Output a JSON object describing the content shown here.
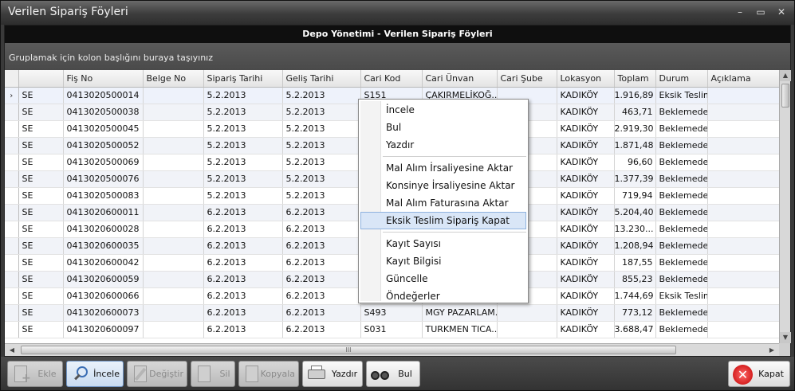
{
  "window": {
    "title": "Verilen Sipariş Föyleri",
    "controls": [
      "–",
      "▭",
      "✕"
    ]
  },
  "panel": {
    "header": "Depo Yönetimi - Verilen Sipariş Föyleri",
    "group_hint": "Gruplamak için kolon başlığını buraya taşıyınız"
  },
  "grid": {
    "columns": [
      "",
      "Fiş No",
      "Belge No",
      "Sipariş Tarihi",
      "Geliş Tarihi",
      "Cari Kod",
      "Cari Ünvan",
      "Cari Şube",
      "Lokasyon",
      "Toplam",
      "Durum",
      "Açıklama"
    ],
    "rows": [
      [
        "SE",
        "0413020500014",
        "",
        "5.2.2013",
        "5.2.2013",
        "S151",
        "ÇAKIRMELİKOĞ...",
        "",
        "KADIKÖY",
        "1.916,89",
        "Eksik Teslim",
        ""
      ],
      [
        "SE",
        "0413020500038",
        "",
        "5.2.2013",
        "5.2.2013",
        "",
        "",
        "",
        "KADIKÖY",
        "463,71",
        "Beklemede",
        ""
      ],
      [
        "SE",
        "0413020500045",
        "",
        "5.2.2013",
        "5.2.2013",
        "",
        "",
        "",
        "KADIKÖY",
        "2.919,30",
        "Beklemede",
        ""
      ],
      [
        "SE",
        "0413020500052",
        "",
        "5.2.2013",
        "5.2.2013",
        "",
        "",
        "",
        "KADIKÖY",
        "1.871,48",
        "Beklemede",
        ""
      ],
      [
        "SE",
        "0413020500069",
        "",
        "5.2.2013",
        "5.2.2013",
        "",
        "",
        "",
        "KADIKÖY",
        "96,60",
        "Beklemede",
        ""
      ],
      [
        "SE",
        "0413020500076",
        "",
        "5.2.2013",
        "5.2.2013",
        "",
        "",
        "",
        "KADIKÖY",
        "1.377,39",
        "Beklemede",
        ""
      ],
      [
        "SE",
        "0413020500083",
        "",
        "5.2.2013",
        "5.2.2013",
        "",
        "",
        "",
        "KADIKÖY",
        "719,94",
        "Beklemede",
        ""
      ],
      [
        "SE",
        "0413020600011",
        "",
        "6.2.2013",
        "6.2.2013",
        "",
        "",
        "",
        "KADIKÖY",
        "5.204,40",
        "Beklemede",
        ""
      ],
      [
        "SE",
        "0413020600028",
        "",
        "6.2.2013",
        "6.2.2013",
        "",
        "",
        "",
        "KADIKÖY",
        "13.230...",
        "Beklemede",
        ""
      ],
      [
        "SE",
        "0413020600035",
        "",
        "6.2.2013",
        "6.2.2013",
        "",
        "",
        "",
        "KADIKÖY",
        "1.208,94",
        "Beklemede",
        ""
      ],
      [
        "SE",
        "0413020600042",
        "",
        "6.2.2013",
        "6.2.2013",
        "",
        "",
        "",
        "KADIKÖY",
        "187,55",
        "Beklemede",
        ""
      ],
      [
        "SE",
        "0413020600059",
        "",
        "6.2.2013",
        "6.2.2013",
        "",
        "",
        "",
        "KADIKÖY",
        "855,23",
        "Beklemede",
        ""
      ],
      [
        "SE",
        "0413020600066",
        "",
        "6.2.2013",
        "6.2.2013",
        "",
        "",
        "",
        "KADIKÖY",
        "1.744,69",
        "Eksik Teslim",
        ""
      ],
      [
        "SE",
        "0413020600073",
        "",
        "6.2.2013",
        "6.2.2013",
        "S493",
        "MGY PAZARLAM...",
        "",
        "KADIKÖY",
        "773,12",
        "Beklemede",
        ""
      ],
      [
        "SE",
        "0413020600097",
        "",
        "6.2.2013",
        "6.2.2013",
        "S031",
        "TURKMEN TICA...",
        "",
        "KADIKÖY",
        "3.688,47",
        "Beklemede",
        ""
      ]
    ],
    "current_row_marker": "›",
    "scroll_thumb_mark": "III"
  },
  "context_menu": {
    "items": [
      {
        "label": "İncele",
        "highlighted": false
      },
      {
        "label": "Bul",
        "highlighted": false
      },
      {
        "label": "Yazdır",
        "highlighted": false
      },
      {
        "sep": true
      },
      {
        "label": "Mal Alım İrsaliyesine Aktar",
        "highlighted": false
      },
      {
        "label": "Konsinye İrsaliyesine Aktar",
        "highlighted": false
      },
      {
        "label": "Mal Alım Faturasına Aktar",
        "highlighted": false
      },
      {
        "label": "Eksik Teslim Sipariş Kapat",
        "highlighted": true
      },
      {
        "sep": true
      },
      {
        "label": "Kayıt Sayısı",
        "highlighted": false
      },
      {
        "label": "Kayıt Bilgisi",
        "highlighted": false
      },
      {
        "label": "Güncelle",
        "highlighted": false
      },
      {
        "label": "Öndeğerler",
        "highlighted": false
      }
    ]
  },
  "toolbar": {
    "add": "Ekle",
    "view": "İncele",
    "edit": "Değiştir",
    "delete": "Sil",
    "copy": "Kopyala",
    "print": "Yazdır",
    "find": "Bul",
    "close": "Kapat"
  },
  "colors": {
    "accent": "#3c6fb5",
    "highlight": "#d9e6f7",
    "close_red": "#c30000"
  }
}
